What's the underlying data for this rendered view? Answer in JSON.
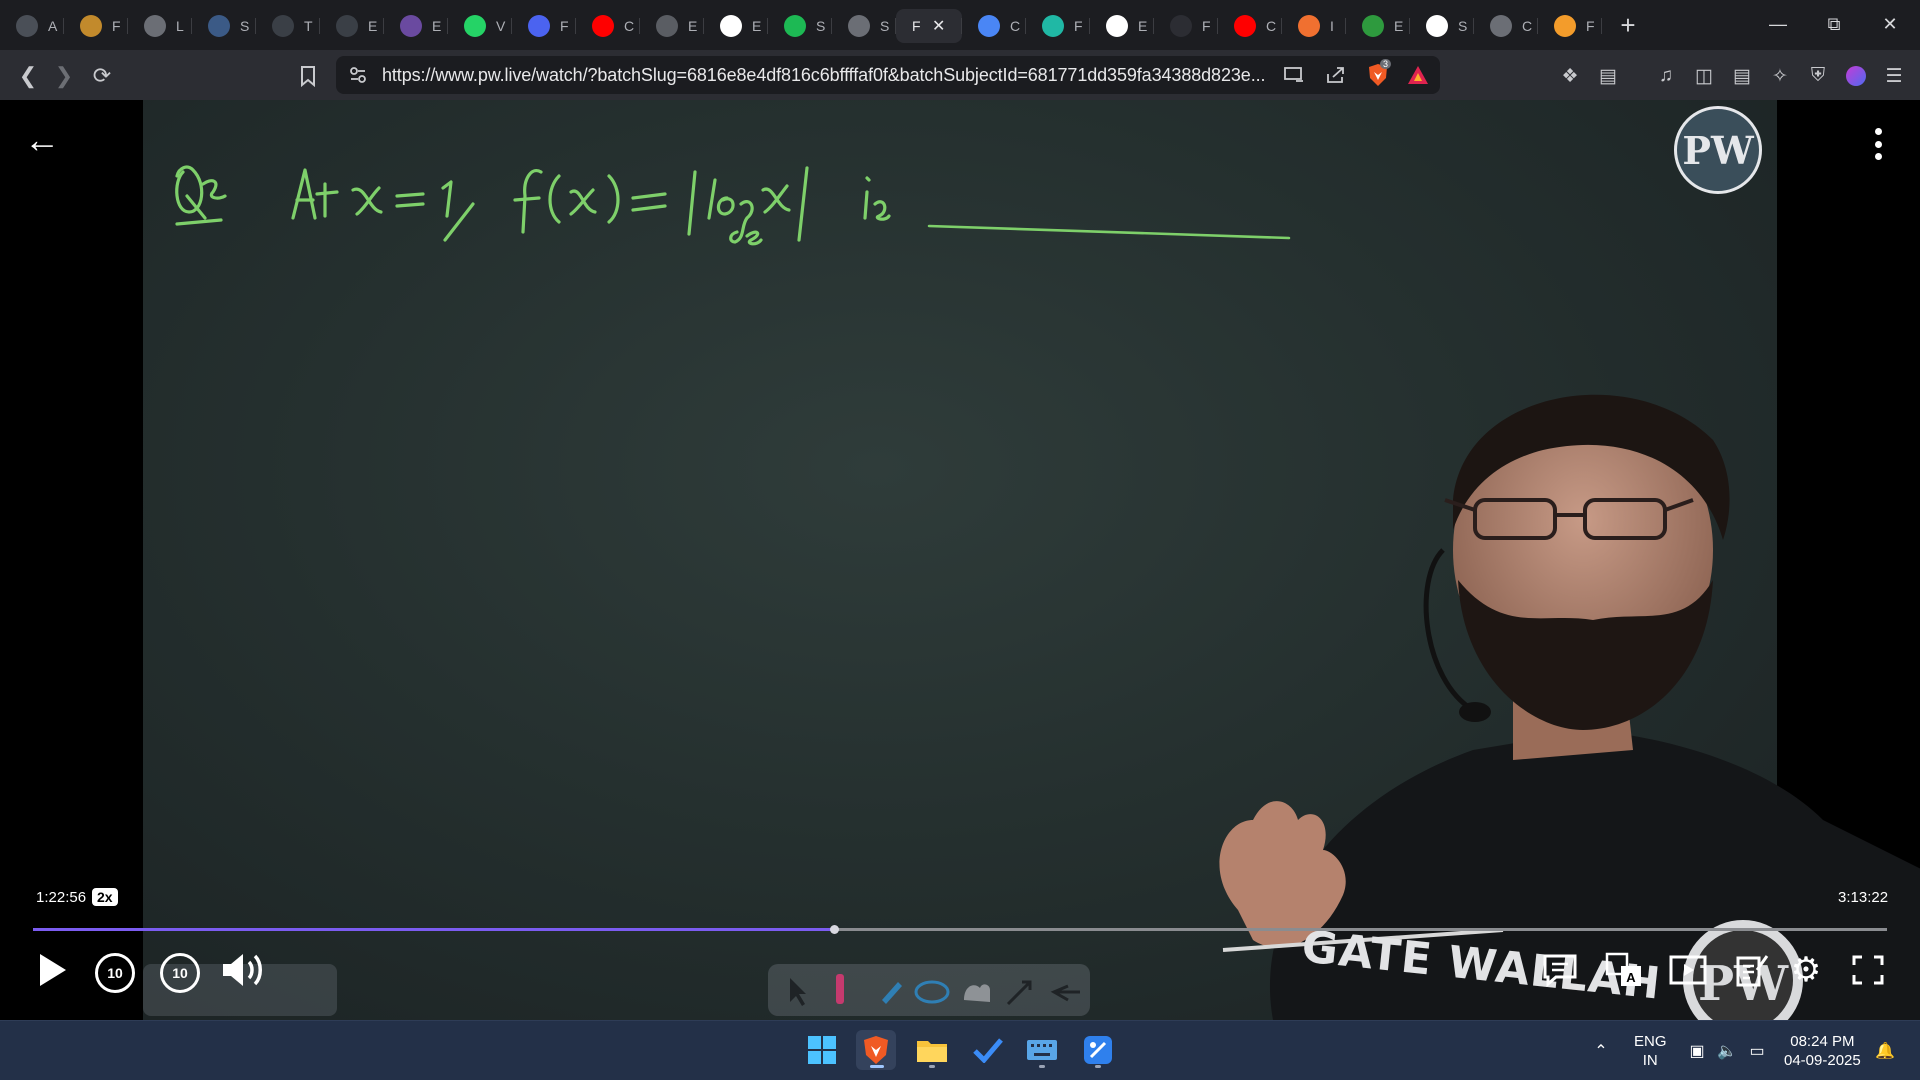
{
  "browser": {
    "tabs": [
      {
        "label": "A",
        "icon": "gpt-icon",
        "color": "#4a4f57"
      },
      {
        "label": "F",
        "icon": "dollar-icon",
        "color": "#c28a2c"
      },
      {
        "label": "L",
        "icon": "globe-icon",
        "color": "#6b6e75"
      },
      {
        "label": "S",
        "icon": "sql-icon",
        "color": "#3b5a86"
      },
      {
        "label": "T",
        "icon": "w3-icon",
        "color": "#3a3f46"
      },
      {
        "label": "E",
        "icon": "hx-icon",
        "color": "#3a3f46"
      },
      {
        "label": "E",
        "icon": "circle-icon",
        "color": "#6a4aa0"
      },
      {
        "label": "V",
        "icon": "whatsapp-icon",
        "color": "#25d366"
      },
      {
        "label": "F",
        "icon": "gem-icon",
        "color": "#4b63f0"
      },
      {
        "label": "C",
        "icon": "youtube-icon",
        "color": "#ff0000"
      },
      {
        "label": "E",
        "icon": "orbs-icon",
        "color": "#5a5d63"
      },
      {
        "label": "E",
        "icon": "google-icon",
        "color": "#ffffff"
      },
      {
        "label": "S",
        "icon": "spotify-icon",
        "color": "#1db954"
      },
      {
        "label": "S",
        "icon": "globe-icon",
        "color": "#6b6e75"
      },
      {
        "label": "F",
        "icon": "none",
        "color": "#2c2d33",
        "active": true
      },
      {
        "label": "C",
        "icon": "gemini-icon",
        "color": "#4a86f5"
      },
      {
        "label": "F",
        "icon": "perplexity-icon",
        "color": "#20b8a5"
      },
      {
        "label": "E",
        "icon": "google-icon",
        "color": "#ffffff"
      },
      {
        "label": "F",
        "icon": "monitor-icon",
        "color": "#2c2d33"
      },
      {
        "label": "C",
        "icon": "youtube-icon",
        "color": "#ff0000"
      },
      {
        "label": "I",
        "icon": "stripe-icon",
        "color": "#f07030"
      },
      {
        "label": "E",
        "icon": "chart-icon",
        "color": "#2e9a3e"
      },
      {
        "label": "S",
        "icon": "wikipedia-icon",
        "color": "#ffffff"
      },
      {
        "label": "C",
        "icon": "globe-icon",
        "color": "#6b6e75"
      },
      {
        "label": "F",
        "icon": "flag-icon",
        "color": "#f39c2b"
      }
    ],
    "url": "https://www.pw.live/watch/?batchSlug=6816e8e4df816c6bffffaf0f&batchSubjectId=681771dd359fa34388d823e...",
    "brave_badge": "3"
  },
  "video": {
    "current_time": "1:22:56",
    "speed": "2x",
    "total_time": "3:13:22",
    "progress": 0.432,
    "board_text": "Q. At x=1, f(x) = |log_e x| is ______",
    "logo_text": "PW",
    "shirt_text": "GATE WALLAH"
  },
  "player": {
    "skip_back": "10",
    "skip_forward": "10"
  },
  "taskbar": {
    "lang_top": "ENG",
    "lang_bottom": "IN",
    "time": "08:24 PM",
    "date": "04-09-2025"
  },
  "colors": {
    "accent_progress": "#7b5cf0",
    "chalk_green": "#7ed06a",
    "taskbar": "#233048"
  }
}
